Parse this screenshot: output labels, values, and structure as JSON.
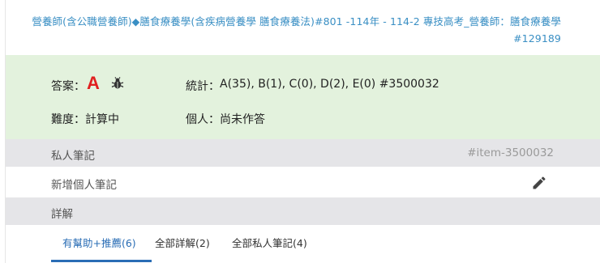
{
  "header": {
    "title": "營養師(含公職營養師)◆膳食療養學(含疾病營養學 膳食療養法)#801 -114年 - 114-2 專技高考_營養師：膳食療養學#129189"
  },
  "answer": {
    "answer_label": "答案：",
    "answer_value": "A",
    "stats_label": "統計：",
    "stats_value": "A(35), B(1), C(0), D(2), E(0) #3500032",
    "difficulty_label": "難度：",
    "difficulty_value": "計算中",
    "personal_label": "個人：",
    "personal_value": "尚未作答",
    "answer_color": "#e02020",
    "background_color": "#e3f2dd"
  },
  "private_notes": {
    "label": "私人筆記",
    "item_id": "#item-3500032",
    "add_note": "新增個人筆記"
  },
  "details": {
    "label": "詳解"
  },
  "tabs": [
    {
      "label": "有幫助+推薦(6)",
      "active": true
    },
    {
      "label": "全部詳解(2)",
      "active": false
    },
    {
      "label": "全部私人筆記(4)",
      "active": false
    }
  ],
  "icons": [
    "bug-icon",
    "pencil-icon"
  ],
  "accent_color": "#2a6db5"
}
